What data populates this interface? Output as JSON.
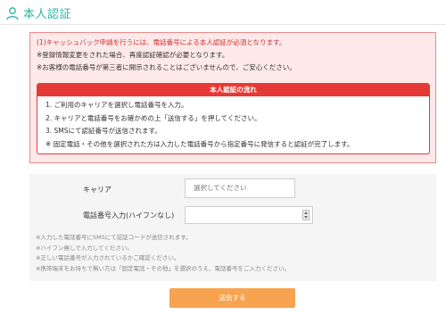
{
  "header": {
    "title": "本人認証",
    "icon": "user-icon",
    "accent_color": "#2bb3a3"
  },
  "alert": {
    "lines": [
      "(1)キャッシュバック申請を行うには、電話番号による本人認証が必須となります。",
      "※登録情報変更をされた場合、再度認証確認が必要となります。",
      "※お客様の電話番号が第三者に開示されることはございませんので、ご安心ください。"
    ],
    "flow": {
      "title": "本人認証の流れ",
      "items": [
        "1. ご利用のキャリアを選択し電話番号を入力。",
        "2. キャリアと電話番号をお確かめの上「送信する」を押してください。",
        "3. SMSにて認証番号が送信されます。",
        "※ 固定電話・その他を選択された方は入力した電話番号から指定番号に発信すると認証が完了します。"
      ]
    },
    "border_color": "#e98a8a",
    "background_color": "#fde9e9",
    "header_color": "#e53935"
  },
  "form": {
    "carrier_label": "キャリア",
    "carrier_placeholder": "選択してください",
    "phone_label": "電話番号入力(ハイフンなし)",
    "phone_value": "",
    "notes": [
      "※入力した電話番号にSMSにて認証コードが送信されます。",
      "※ハイフン無しで入力してください。",
      "※正しい電話番号が入力されているかご確認ください。",
      "※携帯端末をお持ちで無い方は「固定電話・その他」を選択のうえ、電話番号をご入力ください。"
    ]
  },
  "submit": {
    "label": "送信する",
    "color": "#f7a34f"
  }
}
